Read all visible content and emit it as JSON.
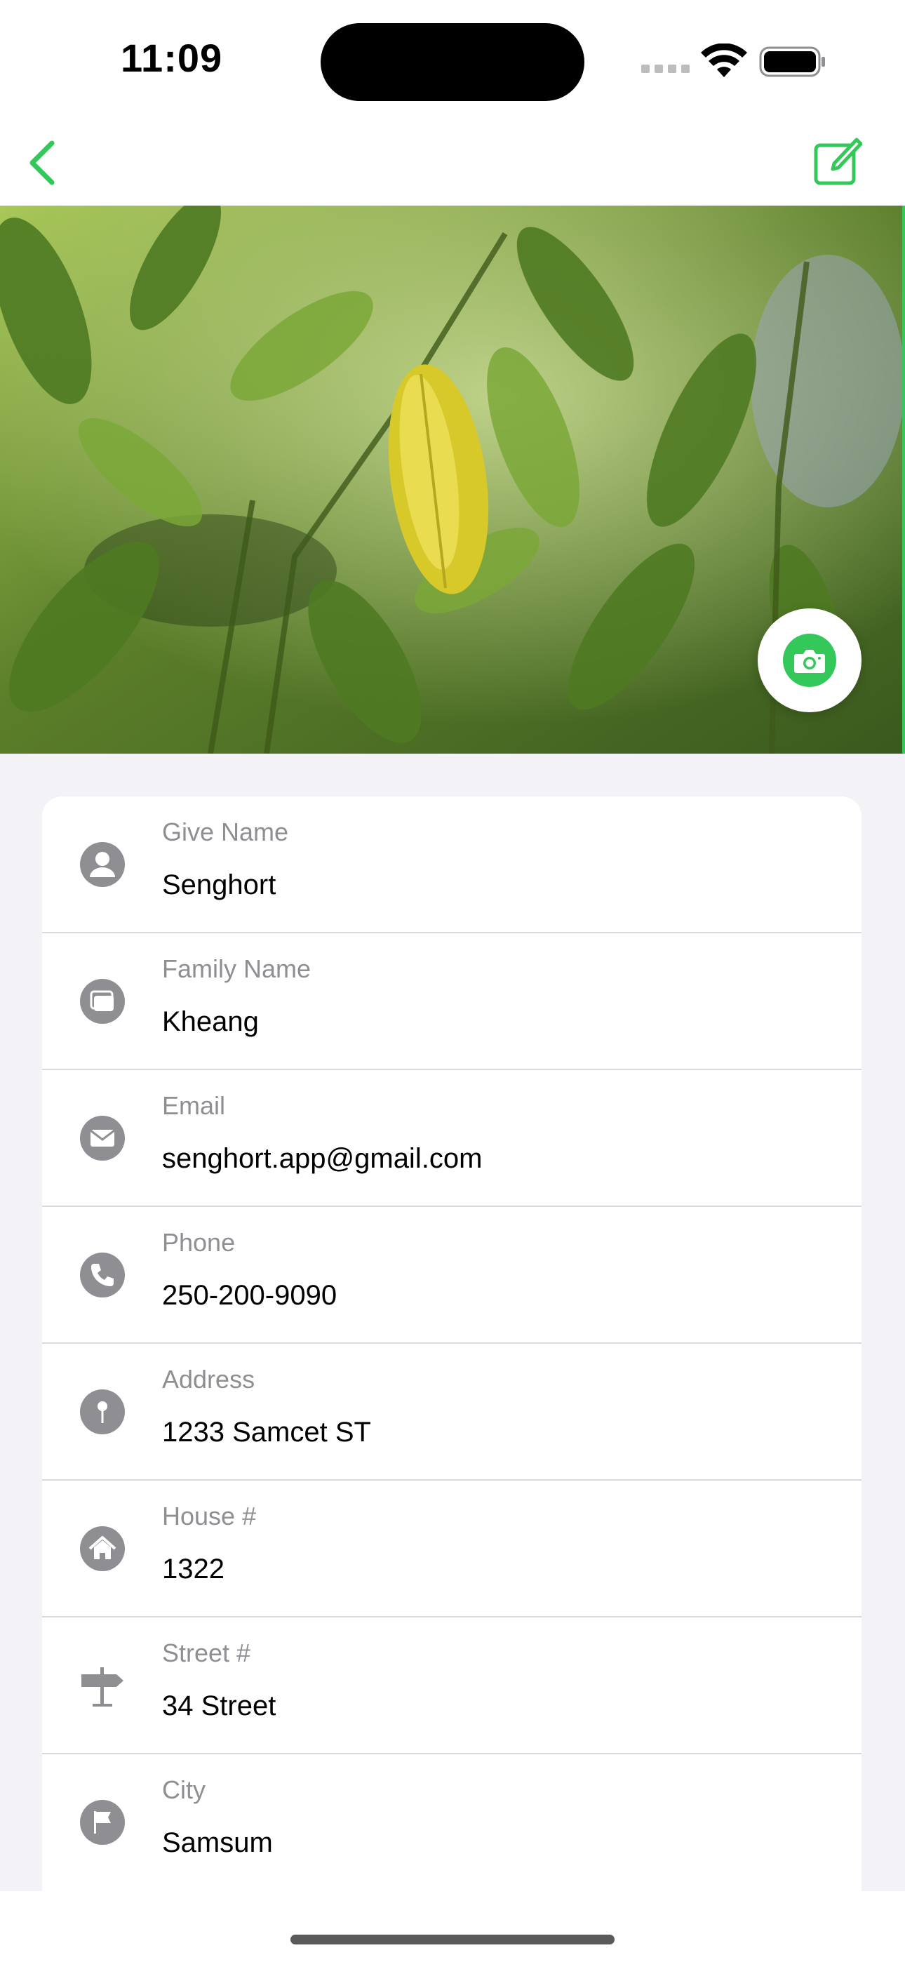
{
  "status": {
    "time": "11:09"
  },
  "colors": {
    "accent": "#34C759",
    "icon_gray": "#8E8E93",
    "background": "#F2F2F7"
  },
  "nav": {
    "back_icon": "chevron-left-icon",
    "edit_icon": "square-pencil-icon"
  },
  "photo": {
    "subject": "leaves",
    "camera_icon": "camera-icon"
  },
  "fields": [
    {
      "label": "Give Name",
      "value": "Senghort",
      "icon": "person-icon"
    },
    {
      "label": "Family Name",
      "value": "Kheang",
      "icon": "rectangles-icon"
    },
    {
      "label": "Email",
      "value": "senghort.app@gmail.com",
      "icon": "envelope-icon"
    },
    {
      "label": "Phone",
      "value": "250-200-9090",
      "icon": "phone-icon"
    },
    {
      "label": "Address",
      "value": "1233 Samcet ST",
      "icon": "pin-icon"
    },
    {
      "label": "House #",
      "value": "1322",
      "icon": "house-icon"
    },
    {
      "label": "Street #",
      "value": "34 Street",
      "icon": "signpost-icon"
    },
    {
      "label": "City",
      "value": "Samsum",
      "icon": "flag-icon"
    }
  ]
}
